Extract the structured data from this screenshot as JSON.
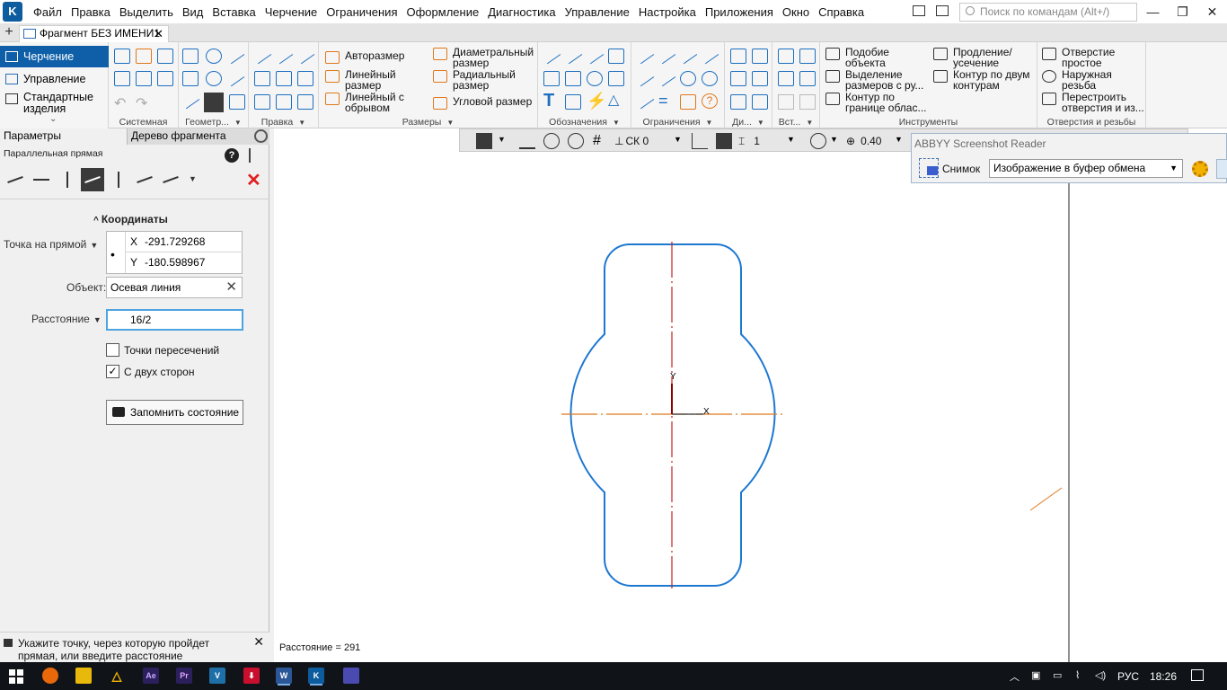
{
  "menubar": {
    "items": [
      "Файл",
      "Правка",
      "Выделить",
      "Вид",
      "Вставка",
      "Черчение",
      "Ограничения",
      "Оформление",
      "Диагностика",
      "Управление",
      "Настройка",
      "Приложения",
      "Окно",
      "Справка"
    ],
    "search_placeholder": "Поиск по командам (Alt+/)"
  },
  "tabs": {
    "document": "Фрагмент БЕЗ ИМЕНИ1"
  },
  "ribbon": {
    "modes": {
      "drawing": "Черчение",
      "manage": "Управление",
      "standard": "Стандартные изделия"
    },
    "groups": [
      "Системная",
      "Геометр...",
      "Правка",
      "Размеры",
      "Обозначения",
      "Ограничения",
      "Ди...",
      "Вст...",
      "Инструменты",
      "Отверстия и резьбы"
    ],
    "dims": {
      "auto": "Авторазмер",
      "linear": "Линейный размер",
      "linear_break": "Линейный с обрывом",
      "diameter": "Диаметральный размер",
      "radial": "Радиальный размер",
      "angular": "Угловой размер"
    },
    "tools": {
      "similar": "Подобие объекта",
      "select_dims": "Выделение размеров с ру...",
      "contour_region": "Контур по границе облас...",
      "extend": "Продление/ усечение",
      "contour_two": "Контур по двум контурам"
    },
    "holes": {
      "simple": "Отверстие простое",
      "thread": "Наружная резьба",
      "rebuild": "Перестроить отверстия и из..."
    }
  },
  "panel": {
    "tab_params": "Параметры",
    "tab_tree": "Дерево фрагмента",
    "command_title": "Параллельная прямая",
    "coords_header": "Координаты",
    "point_label": "Точка на прямой",
    "x_label": "X",
    "x_value": "-291.729268",
    "y_label": "Y",
    "y_value": "-180.598967",
    "object_label": "Объект:",
    "object_value": "Осевая линия",
    "distance_label": "Расстояние",
    "distance_value": "16/2",
    "chk_intersections": "Точки пересечений",
    "chk_intersections_checked": false,
    "chk_both_sides": "С двух сторон",
    "chk_both_sides_checked": true,
    "save_state": "Запомнить состояние",
    "hint": "Укажите точку, через которую пройдет прямая, или введите расстояние"
  },
  "canvas": {
    "toolbar": {
      "cs": "СК 0",
      "layer": "1",
      "zoom": "0.40"
    },
    "status_distance": "Расстояние = 291",
    "axis_x": "X",
    "axis_y": "Y"
  },
  "screenshot_reader": {
    "title": "ABBYY Screenshot Reader",
    "snapshot_label": "Снимок",
    "mode": "Изображение в буфер обмена"
  },
  "taskbar": {
    "lang": "РУС",
    "time": "18:26"
  },
  "colors": {
    "accent": "#0e5fa8",
    "contour": "#1e78d2",
    "axis_red": "#c81e1e",
    "axis_orange": "#e0781a"
  }
}
